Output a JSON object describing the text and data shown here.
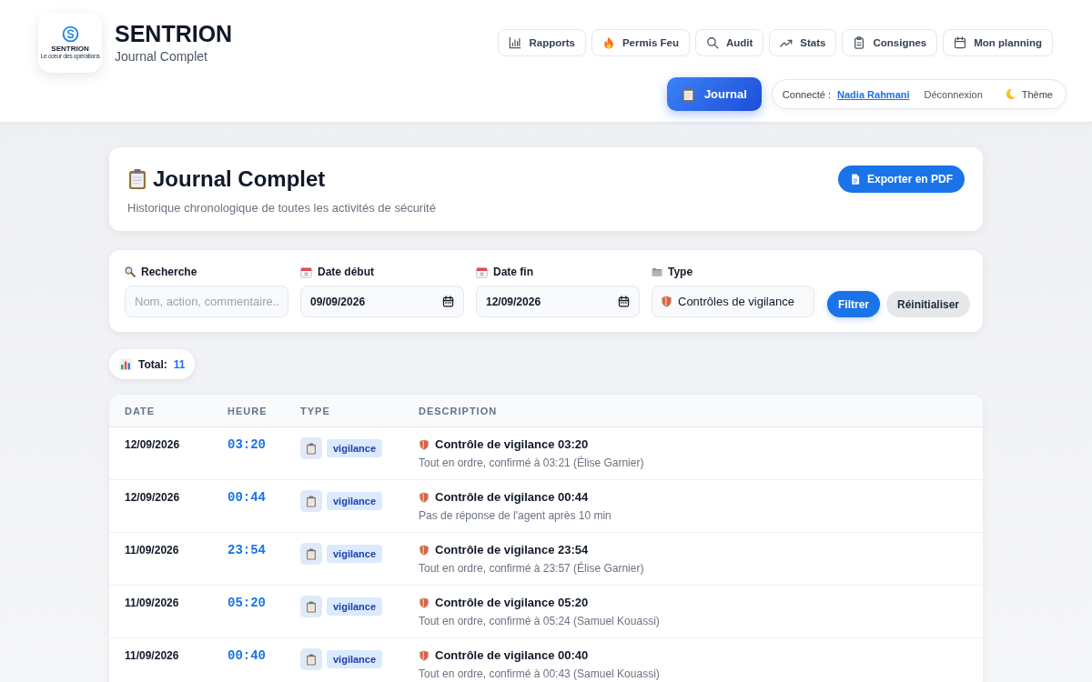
{
  "header": {
    "logo": {
      "name": "SENTRION",
      "tagline": "Le cœur des opérations"
    },
    "brand": "SENTRION",
    "subtitle": "Journal Complet",
    "nav": [
      {
        "label": "Rapports"
      },
      {
        "label": "Permis Feu"
      },
      {
        "label": "Audit"
      },
      {
        "label": "Stats"
      },
      {
        "label": "Consignes"
      },
      {
        "label": "Mon planning"
      }
    ],
    "journal_button": {
      "label": "Journal"
    },
    "user_bar": {
      "connected_label": "Connecté :",
      "user": "Nadia Rahmani",
      "logout": "Déconnexion",
      "theme": "Thème"
    }
  },
  "page_card": {
    "title": "Journal Complet",
    "description": "Historique chronologique de toutes les activités de sécurité",
    "export_button": "Exporter en PDF"
  },
  "filters": {
    "fields": [
      {
        "kind": "text",
        "label": "Recherche",
        "placeholder": "Nom, action, commentaire.."
      },
      {
        "kind": "date",
        "label": "Date début",
        "value": "09/09/2026"
      },
      {
        "kind": "date",
        "label": "Date fin",
        "value": "12/09/2026"
      },
      {
        "kind": "select",
        "label": "Type",
        "value": "Contrôles de vigilance"
      }
    ],
    "buttons": [
      {
        "kind": "primary",
        "label": "Filtrer"
      },
      {
        "kind": "secondary",
        "label": "Réinitialiser"
      }
    ]
  },
  "total": {
    "label": "Total:",
    "value": "11"
  },
  "table": {
    "columns": [
      "DATE",
      "HEURE",
      "TYPE",
      "DESCRIPTION"
    ],
    "rows": [
      {
        "date": "12/09/2026",
        "time": "03:20",
        "type": "vigilance",
        "title": "Contrôle de vigilance 03:20",
        "detail": "Tout en ordre, confirmé à 03:21 (Élise Garnier)"
      },
      {
        "date": "12/09/2026",
        "time": "00:44",
        "type": "vigilance",
        "title": "Contrôle de vigilance 00:44",
        "detail": "Pas de réponse de l'agent après 10 min"
      },
      {
        "date": "11/09/2026",
        "time": "23:54",
        "type": "vigilance",
        "title": "Contrôle de vigilance 23:54",
        "detail": "Tout en ordre, confirmé à 23:57 (Élise Garnier)"
      },
      {
        "date": "11/09/2026",
        "time": "05:20",
        "type": "vigilance",
        "title": "Contrôle de vigilance 05:20",
        "detail": "Tout en ordre, confirmé à 05:24 (Samuel Kouassi)"
      },
      {
        "date": "11/09/2026",
        "time": "00:40",
        "type": "vigilance",
        "title": "Contrôle de vigilance 00:40",
        "detail": "Tout en ordre, confirmé à 00:43 (Samuel Kouassi)"
      }
    ]
  }
}
